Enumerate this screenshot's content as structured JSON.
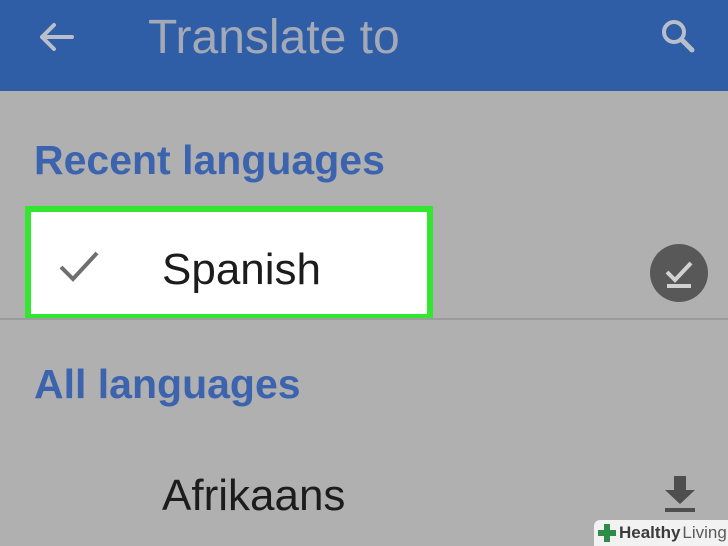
{
  "app_bar": {
    "title": "Translate to",
    "back_icon": "arrow-left-icon",
    "search_icon": "search-icon",
    "background": "#2f5da6"
  },
  "recent": {
    "heading": "Recent languages",
    "items": [
      {
        "label": "Spanish",
        "selected": true,
        "status_icon": "downloaded-check-icon"
      }
    ]
  },
  "all": {
    "heading": "All languages",
    "items": [
      {
        "label": "Afrikaans",
        "status_icon": "download-icon"
      }
    ]
  },
  "colors": {
    "heading": "#3c63ae",
    "highlight_border": "#33e62f",
    "background": "#b0b0b0"
  },
  "watermark": {
    "word1": "Healthy",
    "word2": "Living"
  }
}
